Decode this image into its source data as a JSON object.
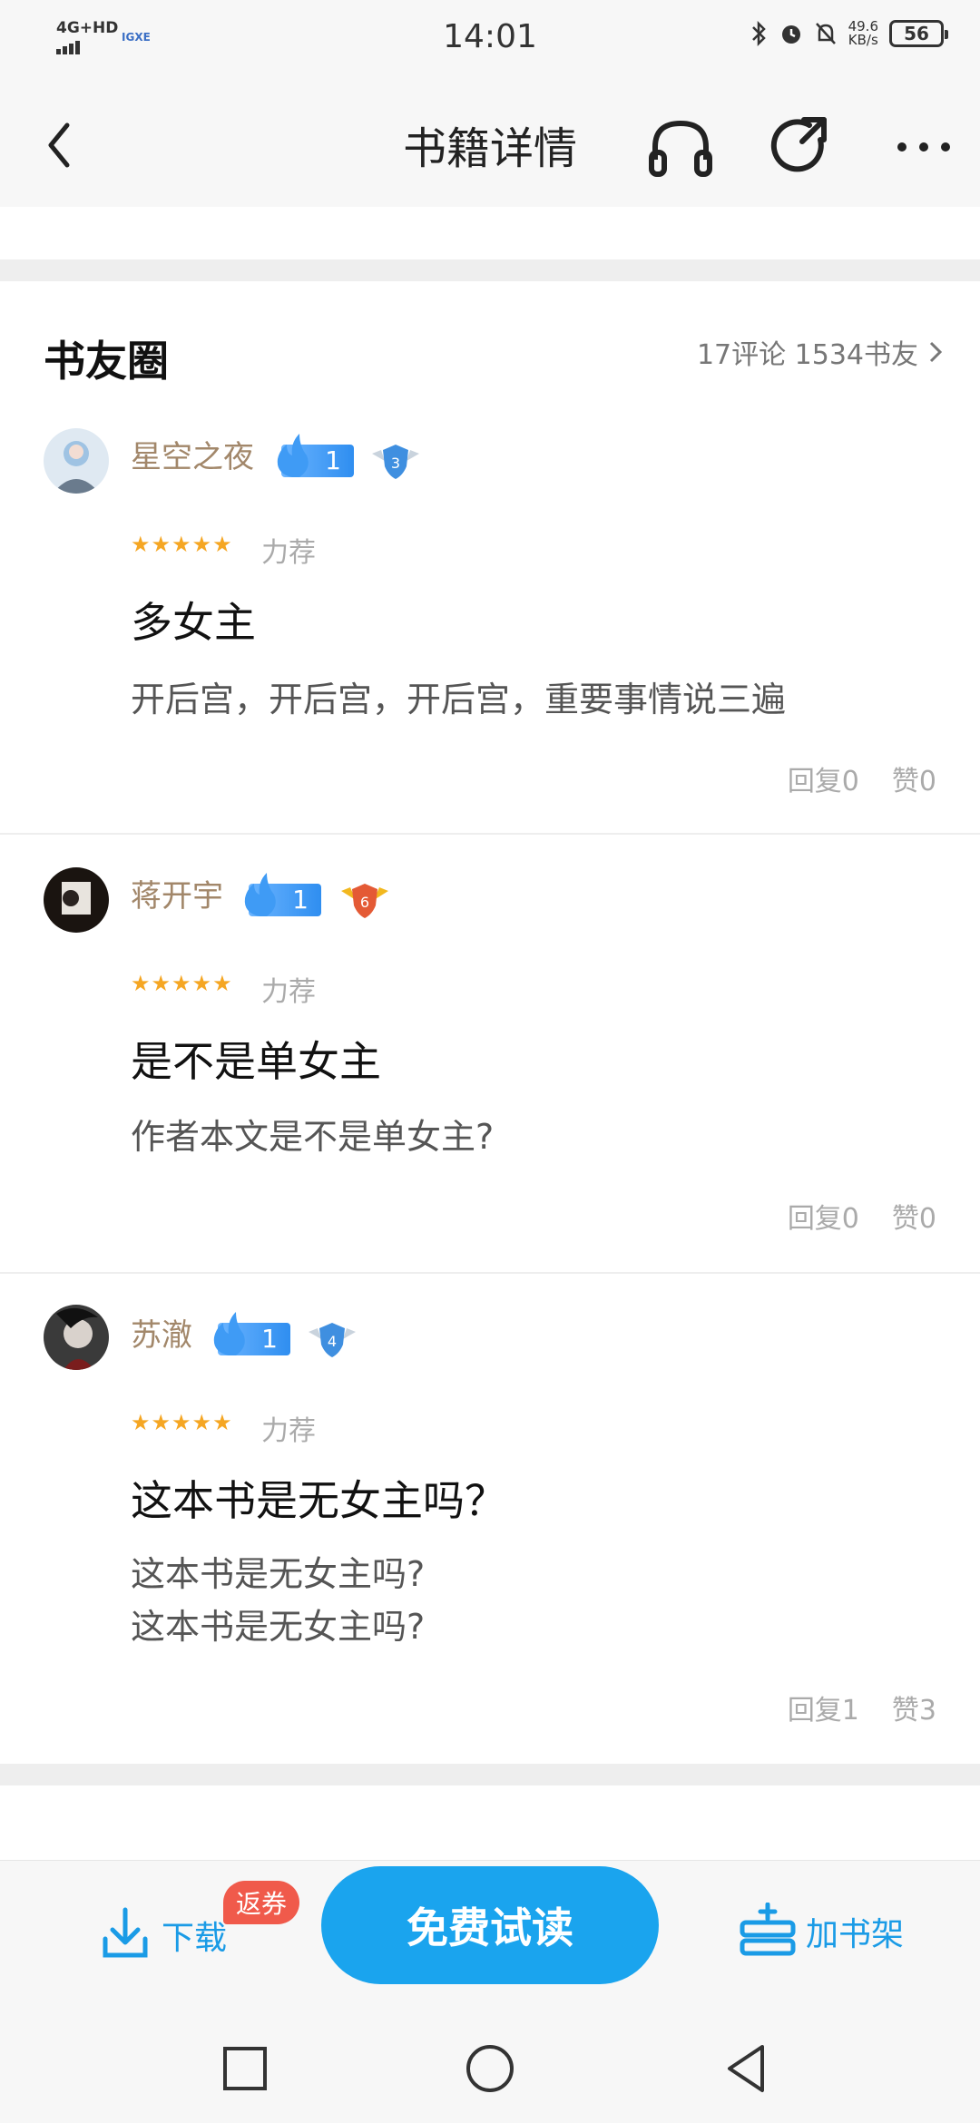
{
  "status_bar": {
    "network": "4G+HD",
    "hd_label": "IGXE",
    "time": "14:01",
    "speed_value": "49.6",
    "speed_unit": "KB/s",
    "battery": "56"
  },
  "header": {
    "title": "书籍详情"
  },
  "circle": {
    "title": "书友圈",
    "stats": "17评论 1534书友"
  },
  "comments": [
    {
      "username": "星空之夜",
      "level": "1",
      "badge": "3",
      "stars": "★★★★★",
      "tag": "力荐",
      "title": "多女主",
      "body": [
        "开后宫，开后宫，开后宫，重要事情说三遍"
      ],
      "reply": "回复0",
      "like": "赞0"
    },
    {
      "username": "蒋开宇",
      "level": "1",
      "badge": "6",
      "stars": "★★★★★",
      "tag": "力荐",
      "title": "是不是单女主",
      "body": [
        "作者本文是不是单女主?"
      ],
      "reply": "回复0",
      "like": "赞0"
    },
    {
      "username": "苏澈",
      "level": "1",
      "badge": "4",
      "stars": "★★★★★",
      "tag": "力荐",
      "title": "这本书是无女主吗？",
      "body": [
        "这本书是无女主吗?",
        "这本书是无女主吗?"
      ],
      "reply": "回复1",
      "like": "赞3"
    }
  ],
  "bottom_bar": {
    "download": "下载",
    "coupon": "返券",
    "read": "免费试读",
    "shelf": "加书架"
  },
  "colors": {
    "accent": "#1aa4ee",
    "username": "#a2876a",
    "coupon": "#f05a4b",
    "stars": "#f5a623"
  }
}
